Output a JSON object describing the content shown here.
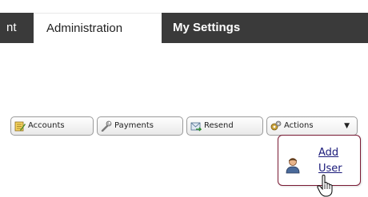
{
  "tabs": {
    "partial_label": "nt",
    "admin_label": "Administration",
    "settings_label": "My Settings"
  },
  "toolbar": {
    "accounts_label": "Accounts",
    "payments_label": "Payments",
    "resend_label": "Resend",
    "actions_label": "Actions",
    "caret_glyph": "▼"
  },
  "actions_menu": {
    "add_user_label": "Add User"
  },
  "colors": {
    "tab_dark": "#3a3a3a",
    "menu_border": "#7a1a34",
    "link": "#1a1a7a"
  },
  "icons": {
    "accounts": "notepad-pencil-icon",
    "payments": "wrench-icon",
    "resend": "envelope-arrow-icon",
    "actions": "gears-icon",
    "add_user": "user-icon",
    "cursor": "hand-pointer-icon"
  }
}
